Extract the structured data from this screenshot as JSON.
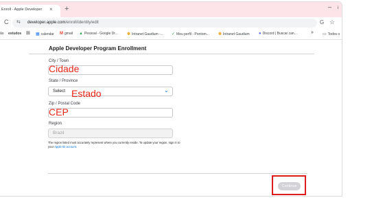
{
  "browser": {
    "tab_title": "Enroll - Apple Developer",
    "tab_close": "×",
    "new_tab": "+",
    "window_minimize": "–",
    "window_extra": "i",
    "reload": "C",
    "site_tune": "⇆",
    "url_host": "developer.apple.com",
    "url_path": "/enroll/identity/edit",
    "translate": "G",
    "star": "☆"
  },
  "bookmarks": {
    "items": [
      {
        "label": "ão",
        "icon": ""
      },
      {
        "label": "estudos",
        "icon": ""
      },
      {
        "label": "",
        "icon": "⊞"
      },
      {
        "label": "calendar",
        "icon": "▦"
      },
      {
        "label": "gmail",
        "icon": "M"
      },
      {
        "label": "Pessoal - Google Dr...",
        "icon": "▲"
      },
      {
        "label": "Intranet Gaudium -...",
        "icon": "✽"
      },
      {
        "label": "Meu perfil - Pontom...",
        "icon": "✓"
      },
      {
        "label": "Intranet Gaudium",
        "icon": "✽"
      },
      {
        "label": "Discord | Buscar can...",
        "icon": "●"
      }
    ],
    "overflow": "»",
    "all_label": "Todos o",
    "all_icon": "▭"
  },
  "form": {
    "title": "Apple Developer Program Enrollment",
    "city_label": "City / Town",
    "city_value": "",
    "city_handwritten": "Cidade",
    "state_label": "State / Province",
    "state_select": "Select",
    "state_handwritten": "Estado",
    "state_chevron": "⌄",
    "zip_label": "Zip / Postal Code",
    "zip_value": "",
    "zip_handwritten": "CEP",
    "region_label": "Region",
    "region_value": "Brazil",
    "note_text": "The region listed must accurately represent where you currently reside. To update your region, sign in to your",
    "note_link": "Apple ID account",
    "note_end": ".",
    "continue_label": "Continue"
  },
  "colors": {
    "annotation_red": "#e8261a",
    "link_blue": "#0071e3",
    "highlight_box": "#e01b1b"
  }
}
